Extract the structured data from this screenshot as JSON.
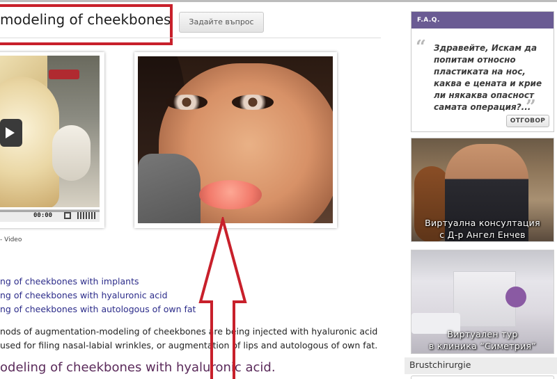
{
  "header": {
    "page_title": "modeling of cheekbones",
    "ask_button_label": "Задайте въпрос"
  },
  "media": {
    "video_time": "00:00",
    "video_caption": "- Video"
  },
  "links": [
    "ng of cheekbones with implants",
    "ng of cheekbones with hyaluronic acid",
    "ng of cheekbones with autologous of own fat"
  ],
  "body": {
    "paragraph_line1": "nods of augmentation-modeling of cheekbones are being injected with hyaluronic acid",
    "paragraph_line2": "used for filing nasal-labial wrinkles, or augmentation of lips and autologous of own fat.",
    "section_heading": "odeling of cheekbones with hyaluronic acid."
  },
  "sidebar": {
    "faq_header": "F.A.Q.",
    "faq_question": "Здравейте, Искам да попитам относно пластиката на нос, каква е цената и крие ли някаква опасност самата операция?...",
    "answer_button": "ОТГОВОР",
    "consult_line1": "Виртуална консултация",
    "consult_line2": "с Д-р Ангел Енчев",
    "tour_line1": "Виртуален тур",
    "tour_line2": "в клиника “Симетрия”",
    "tab_label": "Brustchirurgie"
  },
  "colors": {
    "highlight_red": "#c8202b",
    "faq_header": "#6a5b93",
    "link": "#2c2c8a"
  }
}
